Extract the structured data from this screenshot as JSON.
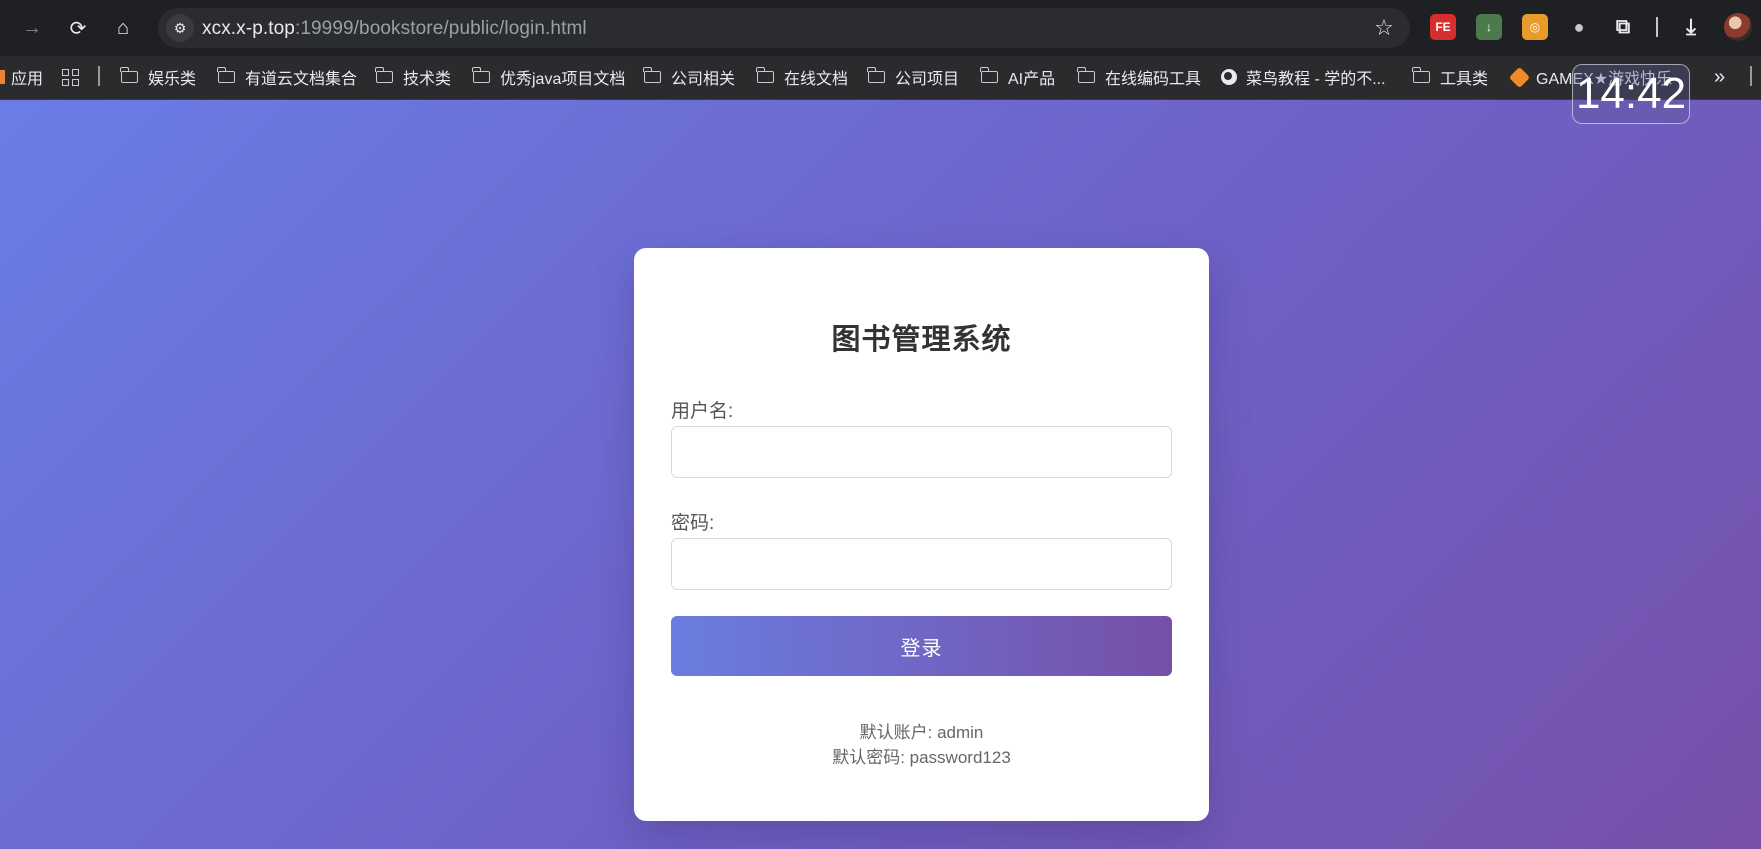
{
  "browser": {
    "url_host": "xcx.x-p.top",
    "url_rest": ":19999/bookstore/public/login.html",
    "bookmarks": [
      {
        "label": "应用"
      },
      {
        "label": "娱乐类"
      },
      {
        "label": "有道云文档集合"
      },
      {
        "label": "技术类"
      },
      {
        "label": "优秀java项目文档"
      },
      {
        "label": "公司相关"
      },
      {
        "label": "在线文档"
      },
      {
        "label": "公司项目"
      },
      {
        "label": "AI产品"
      },
      {
        "label": "在线编码工具"
      },
      {
        "label": "菜鸟教程 - 学的不..."
      },
      {
        "label": "工具类"
      },
      {
        "label": "GAMEX★游戏快乐"
      }
    ],
    "more_label": "»",
    "clock": "14:42"
  },
  "login": {
    "title": "图书管理系统",
    "username_label": "用户名:",
    "username_value": "",
    "password_label": "密码:",
    "password_value": "",
    "submit_label": "登录",
    "default_account": "默认账户: admin",
    "default_password": "默认密码: password123"
  },
  "colors": {
    "gradient_start": "#6a7de6",
    "gradient_end": "#7750aa",
    "card_bg": "#ffffff"
  }
}
